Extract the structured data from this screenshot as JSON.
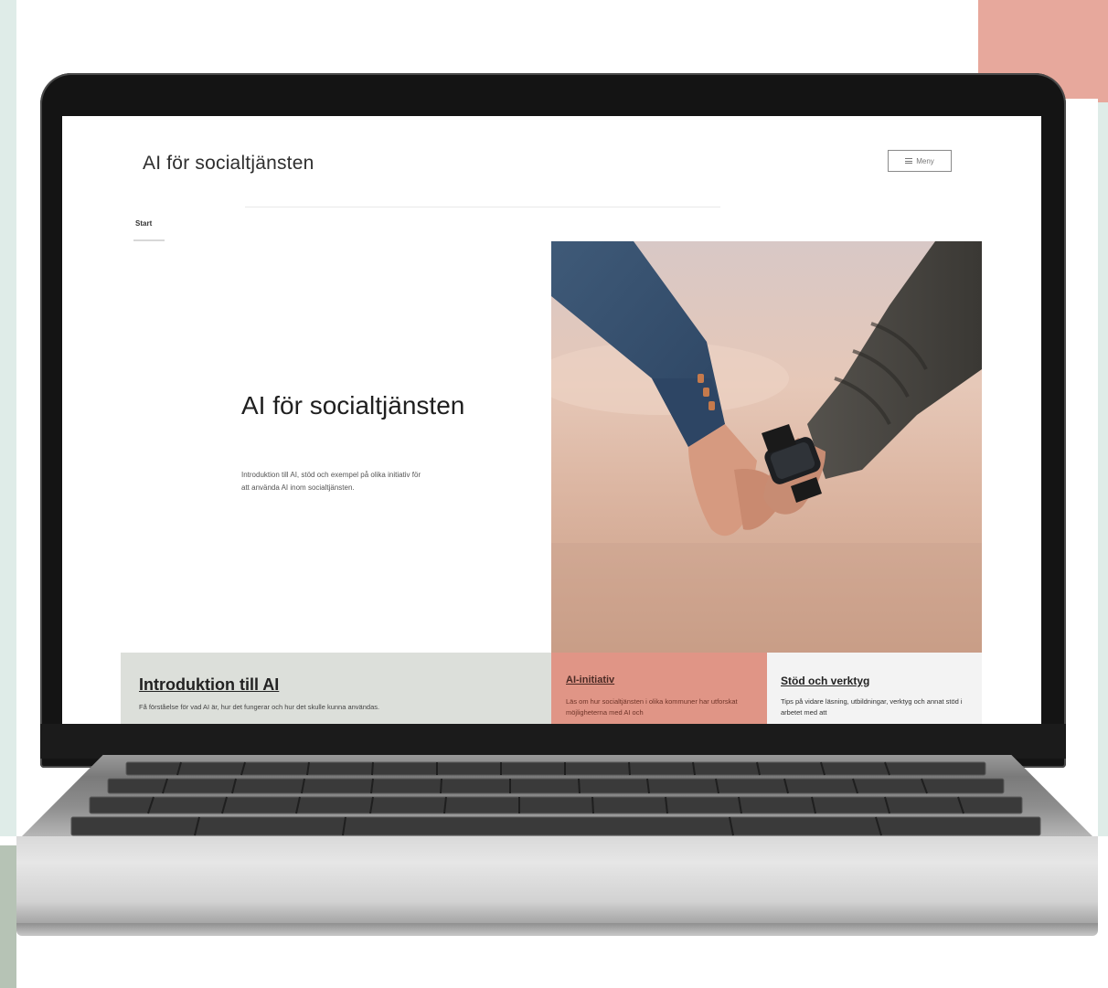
{
  "site": {
    "title": "AI för socialtjänsten",
    "menu_label": "Meny"
  },
  "nav": {
    "items": [
      {
        "label": "Start"
      }
    ]
  },
  "hero": {
    "heading": "AI för socialtjänsten",
    "text": "Introduktion till AI, stöd och exempel på olika initiativ för att använda AI inom socialtjänsten."
  },
  "cards": [
    {
      "title": "Introduktion till AI",
      "text": "Få förståelse för vad AI är, hur det fungerar och hur det skulle kunna användas.",
      "color": "#dcdfda"
    },
    {
      "title": "AI-initiativ",
      "text": "Läs om hur socialtjänsten i olika kommuner har utforskat möjligheterna med AI och",
      "color": "#e09586"
    },
    {
      "title": "Stöd och verktyg",
      "text": "Tips på vidare läsning, utbildningar, verktyg och annat stöd i arbetet med att",
      "color": "#f3f3f3"
    }
  ],
  "colors": {
    "background_mint": "#dfece8",
    "accent_salmon": "#e7a89c",
    "sage": "#b6c3b5"
  },
  "icons": {
    "menu": "hamburger-icon"
  }
}
